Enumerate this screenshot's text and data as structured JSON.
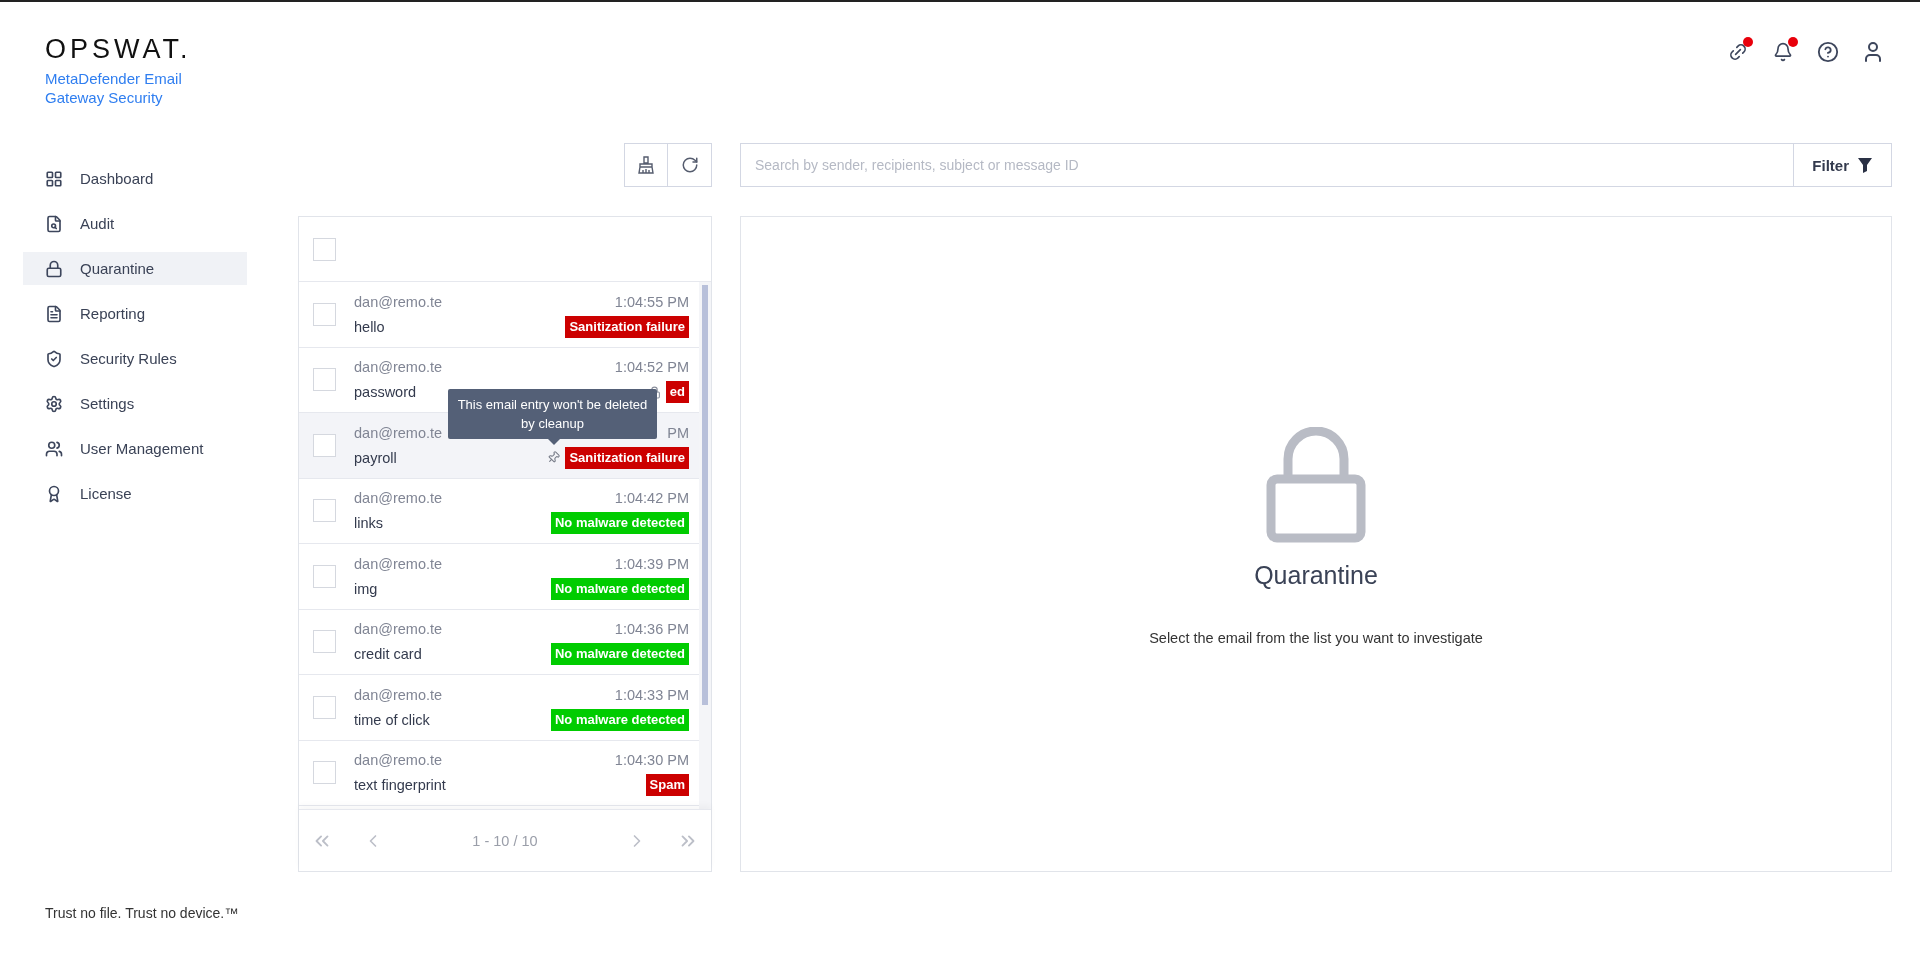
{
  "brand": {
    "logo": "OPSWAT.",
    "product": "MetaDefender Email Gateway Security"
  },
  "header_icons": [
    {
      "kind": "link",
      "alert": true
    },
    {
      "kind": "bell",
      "alert": true
    },
    {
      "kind": "help",
      "alert": false
    },
    {
      "kind": "user",
      "alert": false
    }
  ],
  "sidebar": {
    "items": [
      {
        "kind": "dashboard",
        "label": "Dashboard",
        "selected": false
      },
      {
        "kind": "audit",
        "label": "Audit",
        "selected": false
      },
      {
        "kind": "quarantine",
        "label": "Quarantine",
        "selected": true
      },
      {
        "kind": "reporting",
        "label": "Reporting",
        "selected": false
      },
      {
        "kind": "rules",
        "label": "Security Rules",
        "selected": false
      },
      {
        "kind": "settings",
        "label": "Settings",
        "selected": false
      },
      {
        "kind": "users",
        "label": "User Management",
        "selected": false
      },
      {
        "kind": "license",
        "label": "License",
        "selected": false
      }
    ],
    "footer": "Trust no file. Trust no device.™"
  },
  "toolbar": {
    "search": {
      "placeholder": "Search by sender, recipients, subject or message ID"
    },
    "filter": "Filter"
  },
  "email_list": {
    "select_all": {
      "checked": false
    },
    "rows": [
      {
        "kind": "plain",
        "sender": "dan@remo.te",
        "time": "1:04:55 PM",
        "subject": "hello",
        "status": "Sanitization failure",
        "color": "#cc0000",
        "hovered": false,
        "checked": false
      },
      {
        "kind": "locked",
        "sender": "dan@remo.te",
        "time": "1:04:52 PM",
        "subject": "password",
        "status": "ed",
        "color": "#cc0000",
        "hovered": false,
        "checked": false
      },
      {
        "kind": "pinned",
        "sender": "dan@remo.te",
        "time": "PM",
        "subject": "payroll",
        "status": "Sanitization failure",
        "color": "#cc0000",
        "hovered": true,
        "checked": false
      },
      {
        "kind": "plain",
        "sender": "dan@remo.te",
        "time": "1:04:42 PM",
        "subject": "links",
        "status": "No malware detected",
        "color": "#00cc00",
        "hovered": false,
        "checked": false
      },
      {
        "kind": "plain",
        "sender": "dan@remo.te",
        "time": "1:04:39 PM",
        "subject": "img",
        "status": "No malware detected",
        "color": "#00cc00",
        "hovered": false,
        "checked": false
      },
      {
        "kind": "plain",
        "sender": "dan@remo.te",
        "time": "1:04:36 PM",
        "subject": "credit card",
        "status": "No malware detected",
        "color": "#00cc00",
        "hovered": false,
        "checked": false
      },
      {
        "kind": "plain",
        "sender": "dan@remo.te",
        "time": "1:04:33 PM",
        "subject": "time of click",
        "status": "No malware detected",
        "color": "#00cc00",
        "hovered": false,
        "checked": false
      },
      {
        "kind": "plain",
        "sender": "dan@remo.te",
        "time": "1:04:30 PM",
        "subject": "text fingerprint",
        "status": "Spam",
        "color": "#cc0000",
        "hovered": false,
        "checked": false
      }
    ],
    "tooltip": "This email entry won't be deleted by cleanup",
    "pagination": "1 - 10 / 10"
  },
  "detail": {
    "title": "Quarantine",
    "message": "Select the email from the list you want to investigate"
  }
}
